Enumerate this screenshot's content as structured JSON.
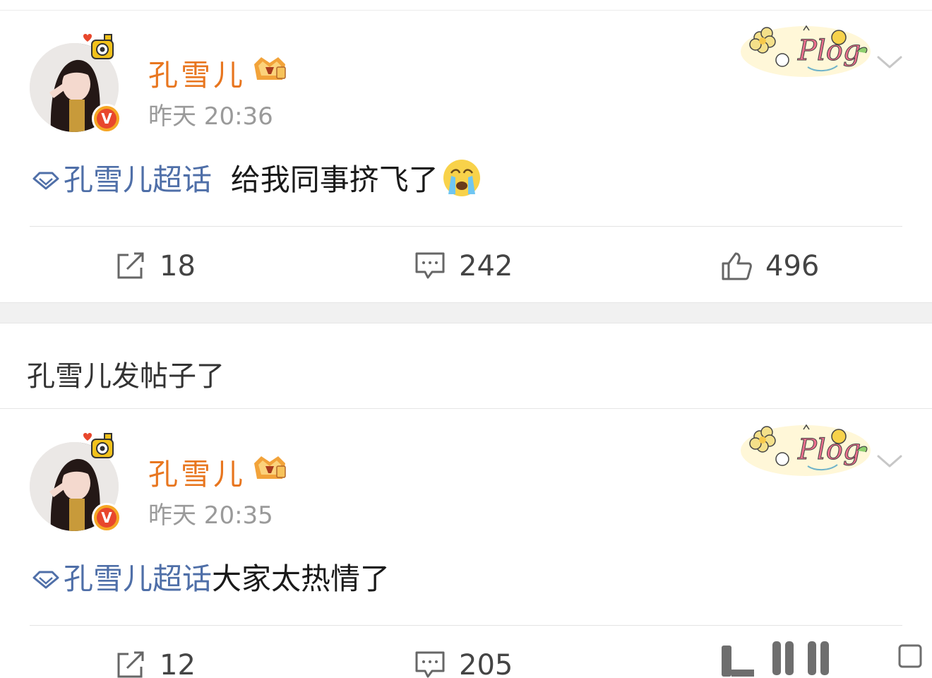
{
  "posts": [
    {
      "author": "孔雪儿",
      "time": "昨天 20:36",
      "topic": "孔雪儿超话",
      "text": "给我同事挤飞了",
      "emoji": "crying-face",
      "sticker_text": "Plog",
      "verify_badge": "V",
      "actions": {
        "reposts": "18",
        "comments": "242",
        "likes": "496"
      }
    },
    {
      "author": "孔雪儿",
      "time": "昨天 20:35",
      "topic": "孔雪儿超话",
      "text": "大家太热情了",
      "sticker_text": "Plog",
      "verify_badge": "V",
      "actions": {
        "reposts": "12",
        "comments": "205"
      }
    }
  ],
  "section_label": "孔雪儿发帖子了",
  "colors": {
    "username": "#e8761f",
    "topic": "#4f6fa8",
    "muted": "#9a9a9a",
    "text": "#1a1a1a"
  }
}
